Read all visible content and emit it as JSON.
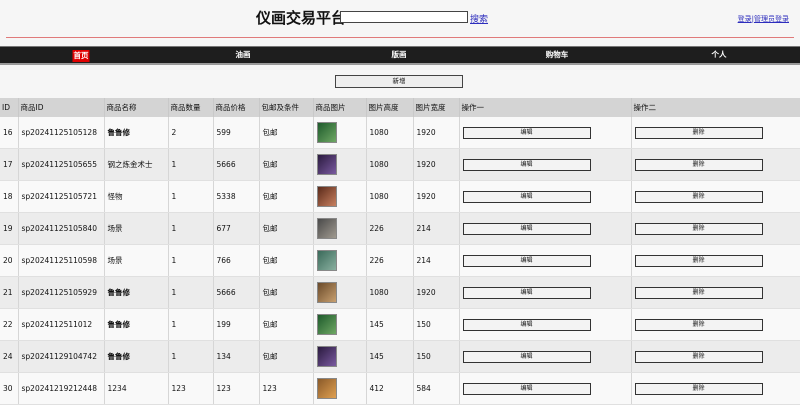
{
  "header": {
    "title": "仪画交易平台",
    "search_placeholder": "",
    "search_label": "搜索",
    "login_label": "登录",
    "separator": "|",
    "admin_login_label": "管理员登录"
  },
  "nav": {
    "items": [
      {
        "label": "首页",
        "active": true
      },
      {
        "label": "油画",
        "active": false
      },
      {
        "label": "版画",
        "active": false
      },
      {
        "label": "购物车",
        "active": false
      },
      {
        "label": "个人",
        "active": false
      }
    ]
  },
  "toolbar": {
    "add_label": "新增"
  },
  "table": {
    "columns": [
      "ID",
      "商品ID",
      "商品名称",
      "商品数量",
      "商品价格",
      "包邮及条件",
      "商品图片",
      "图片高度",
      "图片宽度",
      "操作一",
      "操作二"
    ],
    "edit_label": "编辑",
    "delete_label": "删除",
    "rows": [
      {
        "id": "16",
        "product_id": "sp20241125105128",
        "name": "鲁鲁修",
        "quantity": "2",
        "price": "599",
        "shipping": "包邮",
        "height": "1080",
        "width": "1920",
        "bold": true,
        "thumb_colors": [
          "#1e5a2c",
          "#6fa864"
        ]
      },
      {
        "id": "17",
        "product_id": "sp20241125105655",
        "name": "钢之炼金术士",
        "quantity": "1",
        "price": "5666",
        "shipping": "包邮",
        "height": "1080",
        "width": "1920",
        "bold": false,
        "thumb_colors": [
          "#2a1a3e",
          "#7a5aa0"
        ]
      },
      {
        "id": "18",
        "product_id": "sp20241125105721",
        "name": "怪物",
        "quantity": "1",
        "price": "5338",
        "shipping": "包邮",
        "height": "1080",
        "width": "1920",
        "bold": false,
        "thumb_colors": [
          "#5a2a1a",
          "#c88060"
        ]
      },
      {
        "id": "19",
        "product_id": "sp20241125105840",
        "name": "场景",
        "quantity": "1",
        "price": "677",
        "shipping": "包邮",
        "height": "226",
        "width": "214",
        "bold": false,
        "thumb_colors": [
          "#4a4a4a",
          "#a09a90"
        ]
      },
      {
        "id": "20",
        "product_id": "sp20241125110598",
        "name": "场景",
        "quantity": "1",
        "price": "766",
        "shipping": "包邮",
        "height": "226",
        "width": "214",
        "bold": false,
        "thumb_colors": [
          "#3a6a5a",
          "#8ab0a0"
        ]
      },
      {
        "id": "21",
        "product_id": "sp20241125105929",
        "name": "鲁鲁修",
        "quantity": "1",
        "price": "5666",
        "shipping": "包邮",
        "height": "1080",
        "width": "1920",
        "bold": true,
        "thumb_colors": [
          "#6a4a2a",
          "#c8a070"
        ]
      },
      {
        "id": "22",
        "product_id": "sp2024112511012",
        "name": "鲁鲁修",
        "quantity": "1",
        "price": "199",
        "shipping": "包邮",
        "height": "145",
        "width": "150",
        "bold": true,
        "thumb_colors": [
          "#1e5a2c",
          "#6fa864"
        ]
      },
      {
        "id": "24",
        "product_id": "sp20241129104742",
        "name": "鲁鲁修",
        "quantity": "1",
        "price": "134",
        "shipping": "包邮",
        "height": "145",
        "width": "150",
        "bold": true,
        "thumb_colors": [
          "#2a1a3e",
          "#7a5aa0"
        ]
      },
      {
        "id": "30",
        "product_id": "sp20241219212448",
        "name": "1234",
        "quantity": "123",
        "price": "123",
        "shipping": "123",
        "height": "412",
        "width": "584",
        "bold": false,
        "thumb_colors": [
          "#8a5a2a",
          "#e0a050"
        ]
      }
    ]
  }
}
